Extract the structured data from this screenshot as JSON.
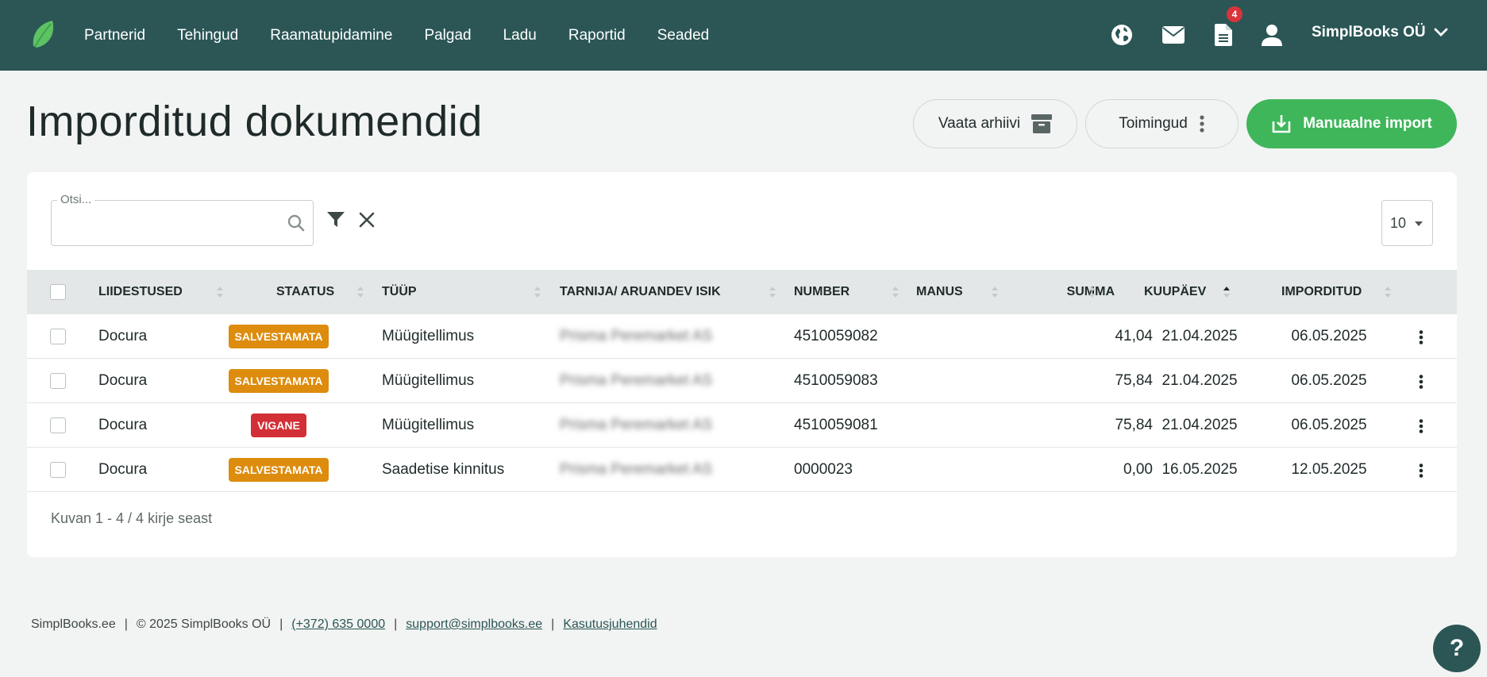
{
  "nav": {
    "items": [
      {
        "label": "Partnerid"
      },
      {
        "label": "Tehingud"
      },
      {
        "label": "Raamatupidamine"
      },
      {
        "label": "Palgad"
      },
      {
        "label": "Ladu"
      },
      {
        "label": "Raportid"
      },
      {
        "label": "Seaded"
      }
    ],
    "notifications_count": "4",
    "company": "SimplBooks OÜ"
  },
  "page": {
    "title": "Imporditud dokumendid",
    "archive_label": "Vaata arhiivi",
    "actions_label": "Toimingud",
    "import_label": "Manuaalne import"
  },
  "search": {
    "label": "Otsi...",
    "value": ""
  },
  "page_size": "10",
  "table": {
    "columns": [
      "LIIDESTUSED",
      "STAATUS",
      "TÜÜP",
      "TARNIJA/ ARUANDEV ISIK",
      "NUMBER",
      "MANUS",
      "SUMMA",
      "KUUPÄEV",
      "IMPORDITUD"
    ],
    "rows": [
      {
        "integration": "Docura",
        "status": "SALVESTAMATA",
        "type": "Müügitellimus",
        "supplier": "Prisma Peremarket AS",
        "number": "4510059082",
        "attachment": "",
        "amount": "41,04",
        "date": "21.04.2025",
        "imported": "06.05.2025"
      },
      {
        "integration": "Docura",
        "status": "SALVESTAMATA",
        "type": "Müügitellimus",
        "supplier": "Prisma Peremarket AS",
        "number": "4510059083",
        "attachment": "",
        "amount": "75,84",
        "date": "21.04.2025",
        "imported": "06.05.2025"
      },
      {
        "integration": "Docura",
        "status": "VIGANE",
        "type": "Müügitellimus",
        "supplier": "Prisma Peremarket AS",
        "number": "4510059081",
        "attachment": "",
        "amount": "75,84",
        "date": "21.04.2025",
        "imported": "06.05.2025"
      },
      {
        "integration": "Docura",
        "status": "SALVESTAMATA",
        "type": "Saadetise kinnitus",
        "supplier": "Prisma Peremarket AS",
        "number": "0000023",
        "attachment": "",
        "amount": "0,00",
        "date": "16.05.2025",
        "imported": "12.05.2025"
      }
    ],
    "summary": "Kuvan 1 - 4 / 4 kirje seast"
  },
  "footer": {
    "site": "SimplBooks.ee",
    "copyright": "© 2025 SimplBooks OÜ",
    "phone": "(+372) 635 0000",
    "email": "support@simplbooks.ee",
    "guides": "Kasutusjuhendid",
    "separator": "|"
  },
  "help_label": "?",
  "colors": {
    "nav_bg": "#2b5655",
    "primary": "#3fb65a",
    "status_warning": "#dd8c0d",
    "status_error": "#d22f36"
  }
}
